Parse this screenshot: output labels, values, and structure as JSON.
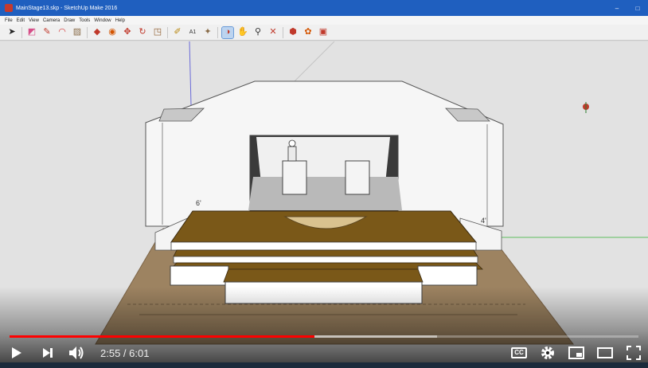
{
  "window": {
    "title": "MainStage13.skp - SketchUp Make 2016",
    "buttons": [
      "–",
      "□"
    ]
  },
  "menu": [
    "File",
    "Edit",
    "View",
    "Camera",
    "Draw",
    "Tools",
    "Window",
    "Help"
  ],
  "toolbar": {
    "tools": [
      {
        "name": "select-tool",
        "glyph": "➤",
        "color": "#222222"
      },
      {
        "name": "eraser-tool",
        "glyph": "◩",
        "color": "#d64e88"
      },
      {
        "name": "pencil-tool",
        "glyph": "✎",
        "color": "#c0392b"
      },
      {
        "name": "arc-tool",
        "glyph": "◠",
        "color": "#d63a3a"
      },
      {
        "name": "rectangle-tool",
        "glyph": "▨",
        "color": "#8a6d4a"
      },
      {
        "name": "pushpull-tool",
        "glyph": "◆",
        "color": "#c0392b"
      },
      {
        "name": "followme-tool",
        "glyph": "◉",
        "color": "#d35400"
      },
      {
        "name": "move-tool",
        "glyph": "✥",
        "color": "#c0392b"
      },
      {
        "name": "rotate-tool",
        "glyph": "↻",
        "color": "#c0392b"
      },
      {
        "name": "scale-tool",
        "glyph": "◳",
        "color": "#8e5a2b"
      },
      {
        "name": "tapemeasure-tool",
        "glyph": "✐",
        "color": "#b8860b"
      },
      {
        "name": "text-tool",
        "glyph": "A1",
        "color": "#333333"
      },
      {
        "name": "paint-tool",
        "glyph": "✦",
        "color": "#8a6d4a"
      },
      {
        "name": "orbit-tool",
        "glyph": "◑",
        "color": "#c0392b",
        "active": true
      },
      {
        "name": "pan-tool",
        "glyph": "✋",
        "color": "#c9a36b"
      },
      {
        "name": "zoom-tool",
        "glyph": "⚲",
        "color": "#333333"
      },
      {
        "name": "zoomextents-tool",
        "glyph": "✕",
        "color": "#c0392b"
      },
      {
        "name": "warehouse-tool",
        "glyph": "⬢",
        "color": "#c0392b"
      },
      {
        "name": "extension-tool",
        "glyph": "✿",
        "color": "#d35400"
      },
      {
        "name": "components-tool",
        "glyph": "▣",
        "color": "#c0392b"
      }
    ]
  },
  "model": {
    "dimension_labels": [
      "6'",
      "4'"
    ],
    "colors": {
      "floor": "#9d8361",
      "stage_top": "#7a5818",
      "arc": "#d9c28f",
      "wall": "#f6f6f6",
      "step": "#ffffff"
    }
  },
  "player": {
    "current_time": "2:55",
    "duration": "6:01",
    "separator": " / ",
    "played_fraction": 0.4845,
    "buffered_fraction": 0.68,
    "cc_label": "CC",
    "progress_color": "#ff0000"
  }
}
